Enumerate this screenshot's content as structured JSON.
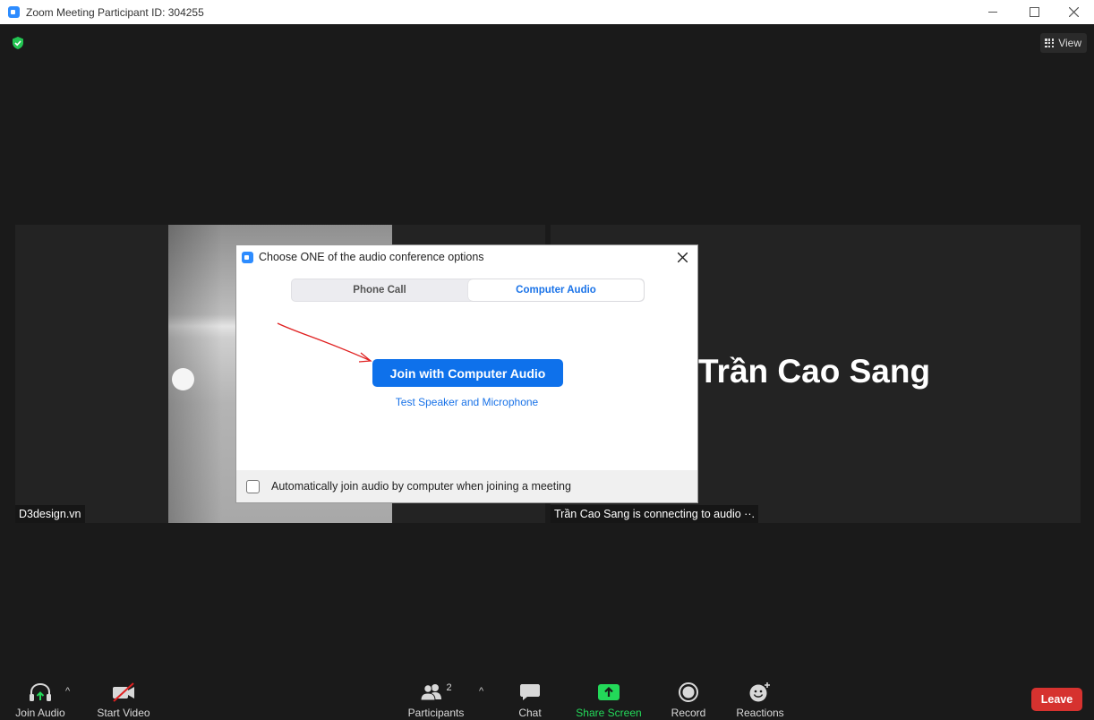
{
  "window": {
    "title": "Zoom Meeting Participant ID: 304255"
  },
  "top_bar": {
    "view_label": "View"
  },
  "participants": [
    {
      "name": "D3design.vn"
    },
    {
      "name": "Trần Cao Sang",
      "status": "Trần Cao Sang is connecting to audio ··."
    }
  ],
  "audio_dialog": {
    "title": "Choose ONE of the audio conference options",
    "tabs": [
      {
        "label": "Phone Call",
        "active": false
      },
      {
        "label": "Computer Audio",
        "active": true
      }
    ],
    "join_button": "Join with Computer Audio",
    "test_link": "Test Speaker and Microphone",
    "auto_join_label": "Automatically join audio by computer when joining a meeting",
    "auto_join_checked": false
  },
  "toolbar": {
    "join_audio": "Join Audio",
    "start_video": "Start Video",
    "participants": "Participants",
    "participants_count": "2",
    "chat": "Chat",
    "share_screen": "Share Screen",
    "record": "Record",
    "reactions": "Reactions",
    "leave": "Leave"
  },
  "colors": {
    "accent": "#0e71eb",
    "share": "#23d959",
    "leave": "#d6322f",
    "annotation": "#e02020"
  }
}
